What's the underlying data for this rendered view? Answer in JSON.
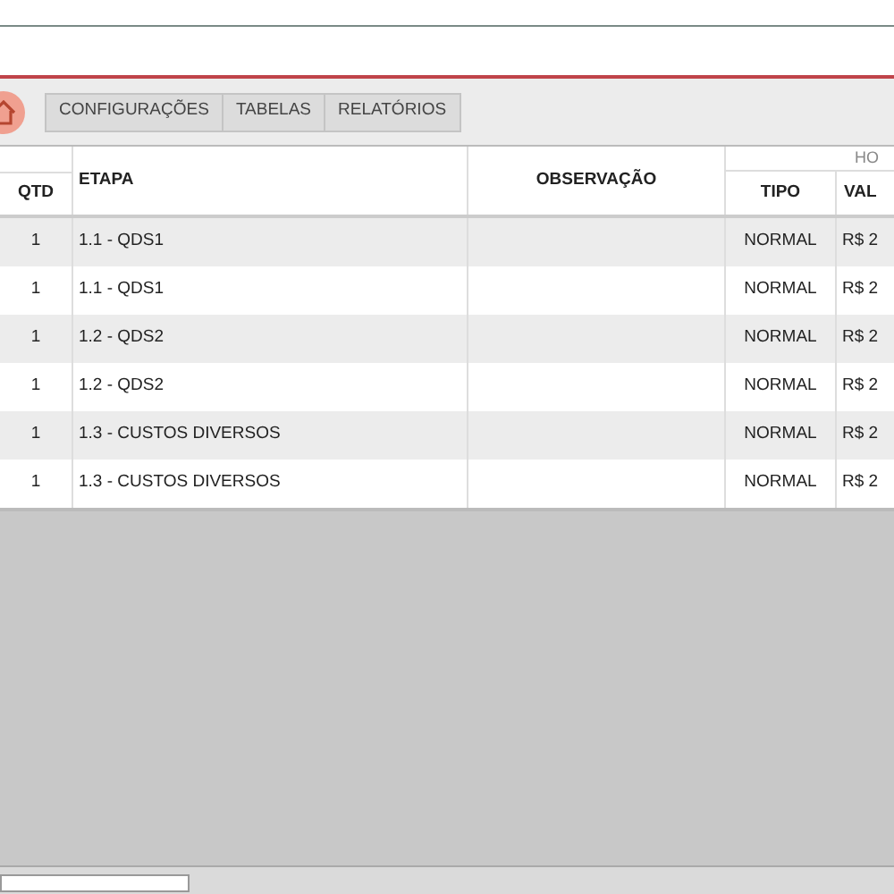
{
  "menu_tabs": [
    {
      "label": "CONFIGURAÇÕES"
    },
    {
      "label": "TABELAS"
    },
    {
      "label": "RELATÓRIOS"
    }
  ],
  "table": {
    "columns": [
      "QTD",
      "ETAPA",
      "OBSERVAÇÃO"
    ],
    "group_header": "HO",
    "sub_columns": [
      "TIPO",
      "VAL"
    ],
    "rows": [
      {
        "qtd": "1",
        "etapa": "1.1 - QDS1",
        "tipo": "NORMAL",
        "valor": "R$ 2"
      },
      {
        "qtd": "1",
        "etapa": "1.1 - QDS1",
        "tipo": "NORMAL",
        "valor": "R$ 2"
      },
      {
        "qtd": "1",
        "etapa": "1.2 - QDS2",
        "tipo": "NORMAL",
        "valor": "R$ 2"
      },
      {
        "qtd": "1",
        "etapa": "1.2 - QDS2",
        "tipo": "NORMAL",
        "valor": "R$ 2"
      },
      {
        "qtd": "1",
        "etapa": "1.3 - CUSTOS DIVERSOS",
        "tipo": "NORMAL",
        "valor": "R$ 2"
      },
      {
        "qtd": "1",
        "etapa": "1.3 - CUSTOS DIVERSOS",
        "tipo": "NORMAL",
        "valor": "R$ 2"
      }
    ]
  }
}
